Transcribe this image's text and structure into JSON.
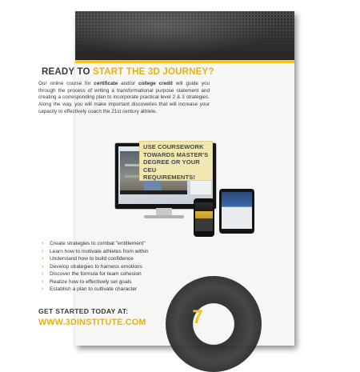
{
  "headline": {
    "lead": "Ready to",
    "accent": "start the 3D journey?"
  },
  "intro": {
    "p1": "Our online course for ",
    "bold1": "certificate",
    "p2": " and/or ",
    "bold2": "college credit",
    "p3": " will guide you through the process of writing a transformational purpose statement and creating a corresponding plan to incorporate practical level 2 & 3 strategies. Along the way, you will make important discoveries that will increase your capacity to effectively coach the 21st century athlete."
  },
  "callout": "Use coursework towards master's degree or your CEU requirements!",
  "bullets": [
    "Create strategies to combat \"entitlement\"",
    "Learn how to motivate athletes from within",
    "Understand how to build confidence",
    "Develop strategies to harness emotions",
    "Discover the formula for team cohesion",
    "Realize how to effectively set goals",
    "Establish a plan to cultivate character"
  ],
  "cta": "Get started today at:",
  "url": "www.3DInstitute.com",
  "page_number": "7",
  "colors": {
    "accent": "#e7b10f",
    "header": "#2f2f2f",
    "text": "#3a3a3a"
  },
  "icons": {
    "bullet": "chevron-right-icon"
  }
}
